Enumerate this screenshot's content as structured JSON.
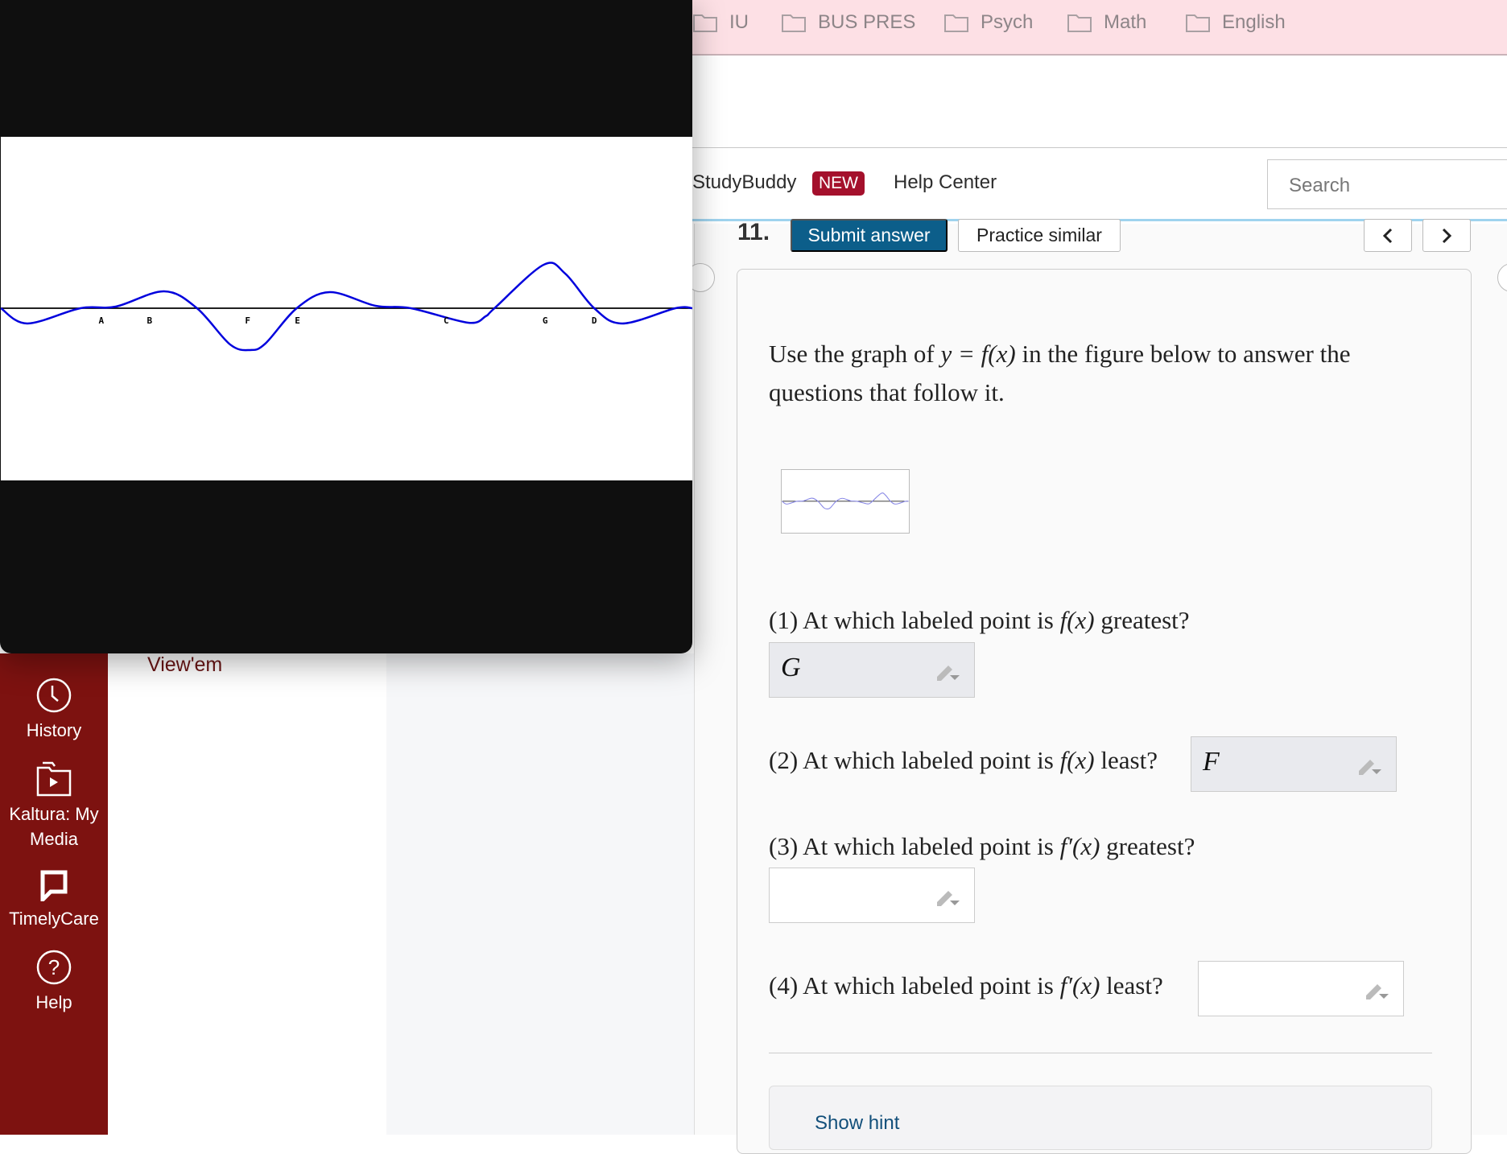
{
  "bookmarks": [
    "IU",
    "BUS PRES",
    "Psych",
    "Math",
    "English"
  ],
  "header": {
    "studybuddy": "StudyBuddy",
    "new_badge": "NEW",
    "help_center": "Help Center",
    "search_placeholder": "Search"
  },
  "sidebar": {
    "items": [
      {
        "label": "History",
        "icon": "clock-icon"
      },
      {
        "label": "Kaltura: My Media",
        "icon": "media-folder-icon"
      },
      {
        "label": "TimelyCare",
        "icon": "chat-flag-icon"
      },
      {
        "label": "Help",
        "icon": "help-circle-icon"
      }
    ]
  },
  "left_link": "View'em",
  "toolbar": {
    "question_number": "11.",
    "submit": "Submit answer",
    "practice": "Practice similar"
  },
  "question": {
    "intro_a": "Use the graph of ",
    "intro_math": "y = f(x)",
    "intro_b": " in the figure below to answer the",
    "intro_c": "questions that follow it.",
    "parts": [
      {
        "prefix": "(1) At which labeled point is ",
        "math": "f(x)",
        "suffix": " greatest?",
        "answer": "G"
      },
      {
        "prefix": "(2) At which labeled point is ",
        "math": "f(x)",
        "suffix": " least?",
        "answer": "F"
      },
      {
        "prefix": "(3) At which labeled point is ",
        "math": "f′(x)",
        "suffix": " greatest?",
        "answer": ""
      },
      {
        "prefix": "(4) At which labeled point is ",
        "math": "f′(x)",
        "suffix": " least?",
        "answer": ""
      }
    ],
    "show_hint": "Show hint"
  },
  "graph": {
    "labels": [
      "A",
      "B",
      "F",
      "E",
      "C",
      "G",
      "D"
    ],
    "curve_color": "#0000dd"
  }
}
